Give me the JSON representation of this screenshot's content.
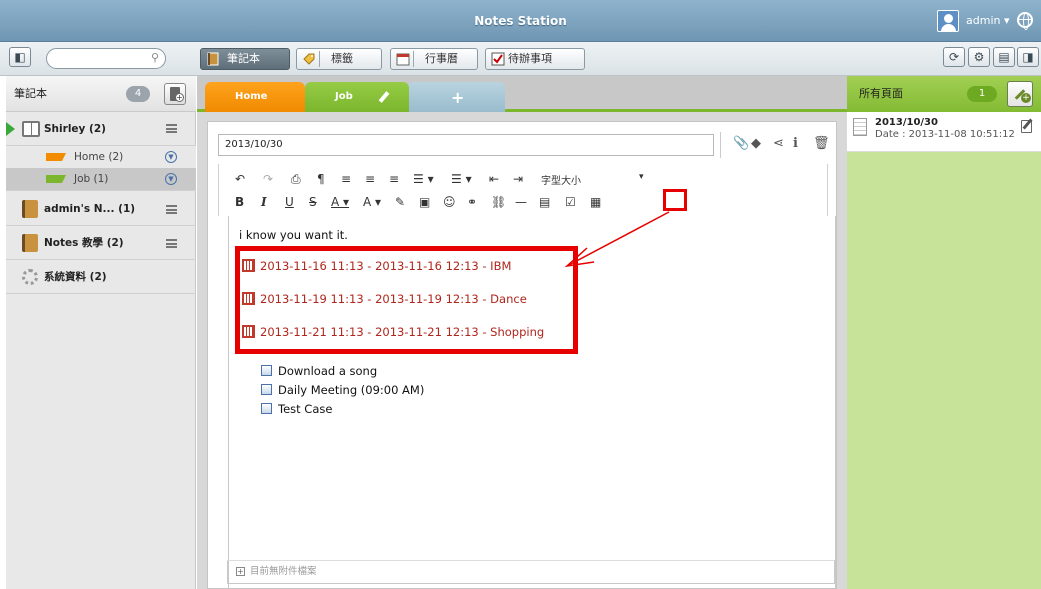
{
  "app": {
    "title": "Notes Station",
    "user": "admin ▾"
  },
  "toolbar": {
    "search_placeholder": "",
    "nav": [
      {
        "label": "筆記本",
        "icon": "notebook-icon",
        "active": true
      },
      {
        "label": "標籤",
        "icon": "tag-icon",
        "active": false
      },
      {
        "label": "行事曆",
        "icon": "calendar-icon",
        "active": false
      },
      {
        "label": "待辦事項",
        "icon": "checkbox-icon",
        "active": false
      }
    ],
    "right_icons": [
      "refresh-icon",
      "settings-icon",
      "layout-icon",
      "panel-icon"
    ]
  },
  "sidebar": {
    "header": "筆記本",
    "count": "4",
    "notebooks": [
      {
        "label": "Shirley (2)",
        "sections": [
          {
            "label": "Home (2)",
            "color": "#f28c00"
          },
          {
            "label": "Job (1)",
            "color": "#7bb62d"
          }
        ]
      },
      {
        "label": "admin's N... (1)"
      },
      {
        "label": "Notes 教學 (2)"
      },
      {
        "label": "系統資料 (2)"
      }
    ]
  },
  "tabs": [
    {
      "label": "Home",
      "color": "#f28c00"
    },
    {
      "label": "Job",
      "color": "#7bb62d"
    }
  ],
  "note": {
    "title": "2013/10/30",
    "toolbar_row1": [
      "↶",
      "↷",
      "⎙",
      "¶",
      "≡",
      "≡",
      "≡",
      "☰ ▾",
      "☰ ▾",
      "⇤",
      "⇥",
      "字型大小",
      "▾"
    ],
    "toolbar_row2": [
      "B",
      "I",
      "U",
      "S",
      "A ▾",
      "A ▾",
      "✎",
      "▣",
      "☺",
      "⚭",
      "⛓",
      "—",
      "▤",
      "☑",
      "▦"
    ],
    "body_text": "i know you want it.",
    "events": [
      "2013-11-16 11:13 - 2013-11-16 12:13 - IBM",
      "2013-11-19 11:13 - 2013-11-19 12:13 - Dance",
      "2013-11-21 11:13 - 2013-11-21 12:13 - Shopping"
    ],
    "todos": [
      "Download a song",
      "Daily Meeting (09:00 AM)",
      "Test Case"
    ],
    "attachments": "目前無附件檔案"
  },
  "pages_panel": {
    "header": "所有頁面",
    "count": "1",
    "pages": [
      {
        "title": "2013/10/30",
        "date": "Date : 2013-11-08 10:51:12"
      }
    ]
  },
  "colors": {
    "highlight": "#e60000",
    "accent": "#7bb62d"
  }
}
